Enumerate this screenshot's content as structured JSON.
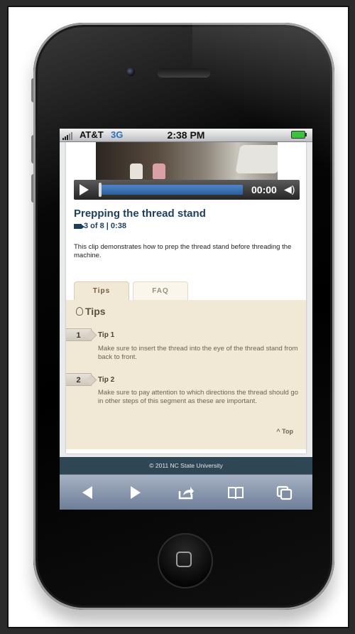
{
  "statusbar": {
    "carrier": "AT&T",
    "network": "3G",
    "time": "2:38 PM"
  },
  "video": {
    "time": "00:00",
    "title": "Prepping the thread stand",
    "meta": "3 of 8 | 0:38",
    "description": "This clip demonstrates how to prep the thread stand before threading the machine."
  },
  "tabs": [
    {
      "label": "Tips"
    },
    {
      "label": "FAQ"
    }
  ],
  "tips": {
    "heading": "Tips",
    "items": [
      {
        "number": "1",
        "title": "Tip 1",
        "text": "Make sure to insert the thread into the eye of the thread stand from back to front."
      },
      {
        "number": "2",
        "title": "Tip 2",
        "text": "Make sure to pay attention to which directions the thread should go in other steps of this segment as these are important."
      }
    ],
    "top_link": "Top"
  },
  "footer": {
    "text": "© 2011 NC State University"
  },
  "toolbar": {
    "icons": [
      "back-icon",
      "forward-icon",
      "share-icon",
      "bookmarks-icon",
      "pages-icon"
    ]
  },
  "colors": {
    "accent": "#1d3f5e",
    "panel": "#f1e8d5",
    "footer": "#2f4655"
  }
}
